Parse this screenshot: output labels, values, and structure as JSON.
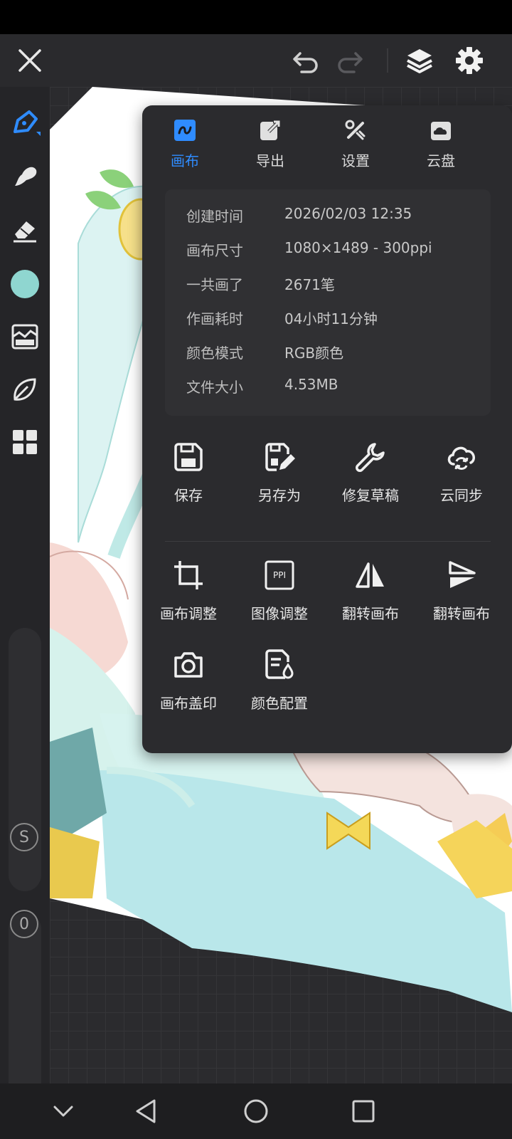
{
  "toolbar": {
    "close_icon": "close-icon",
    "undo_icon": "undo-icon",
    "redo_icon": "redo-icon",
    "layers_icon": "layers-icon",
    "settings_icon": "gear-icon"
  },
  "sidebar": {
    "tools": [
      "pen-tool",
      "smudge-tool",
      "eraser-tool",
      "color-swatch",
      "filter-tool",
      "leaf-tool",
      "grid-tool"
    ],
    "current_color": "#8fd6d0",
    "size_label": "S",
    "opacity_label": "0"
  },
  "panel": {
    "tabs": [
      {
        "label": "画布",
        "icon": "canvas-icon",
        "active": true
      },
      {
        "label": "导出",
        "icon": "export-icon",
        "active": false
      },
      {
        "label": "设置",
        "icon": "settings-tools-icon",
        "active": false
      },
      {
        "label": "云盘",
        "icon": "cloud-drive-icon",
        "active": false
      }
    ],
    "info": [
      {
        "key": "创建时间",
        "value": "2026/02/03 12:35"
      },
      {
        "key": "画布尺寸",
        "value": "1080×1489 - 300ppi"
      },
      {
        "key": "一共画了",
        "value": "2671笔"
      },
      {
        "key": "作画耗时",
        "value": "04小时11分钟"
      },
      {
        "key": "颜色模式",
        "value": "RGB颜色"
      },
      {
        "key": "文件大小",
        "value": "4.53MB"
      }
    ],
    "actions_row1": [
      {
        "label": "保存",
        "icon": "save-icon"
      },
      {
        "label": "另存为",
        "icon": "save-as-icon"
      },
      {
        "label": "修复草稿",
        "icon": "repair-icon"
      },
      {
        "label": "云同步",
        "icon": "cloud-sync-icon"
      }
    ],
    "actions_row2": [
      {
        "label": "画布调整",
        "icon": "crop-icon"
      },
      {
        "label": "图像调整",
        "icon": "ppi-icon",
        "badge": "PPI"
      },
      {
        "label": "翻转画布",
        "icon": "flip-horizontal-icon"
      },
      {
        "label": "翻转画布",
        "icon": "flip-vertical-icon"
      }
    ],
    "actions_row3": [
      {
        "label": "画布盖印",
        "icon": "camera-icon"
      },
      {
        "label": "颜色配置",
        "icon": "color-config-icon"
      }
    ]
  },
  "colors": {
    "accent": "#2f8cff",
    "panel_bg": "#2b2b2e"
  }
}
